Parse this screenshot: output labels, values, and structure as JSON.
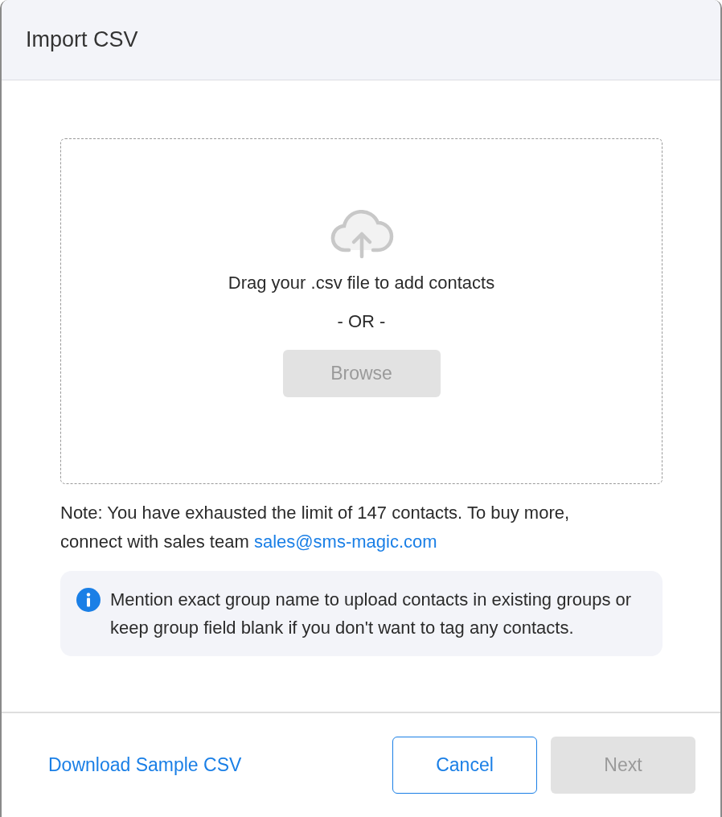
{
  "dialog": {
    "title": "Import CSV"
  },
  "dropzone": {
    "prompt": "Drag your .csv file to add contacts",
    "separator": "- OR -",
    "browse": {
      "label": "Browse",
      "disabled": true
    }
  },
  "note": {
    "text": "Note: You have exhausted the limit of 147 contacts. To buy more, connect with sales team ",
    "link": "sales@sms-magic.com"
  },
  "info": {
    "text": "Mention exact group name to upload contacts in existing groups or keep group field blank if you don't want to tag any contacts."
  },
  "footer": {
    "download_link": "Download Sample CSV",
    "buttons": [
      {
        "label": "Cancel",
        "kind": "secondary",
        "disabled": false
      },
      {
        "label": "Next",
        "kind": "primary",
        "disabled": true
      }
    ]
  }
}
